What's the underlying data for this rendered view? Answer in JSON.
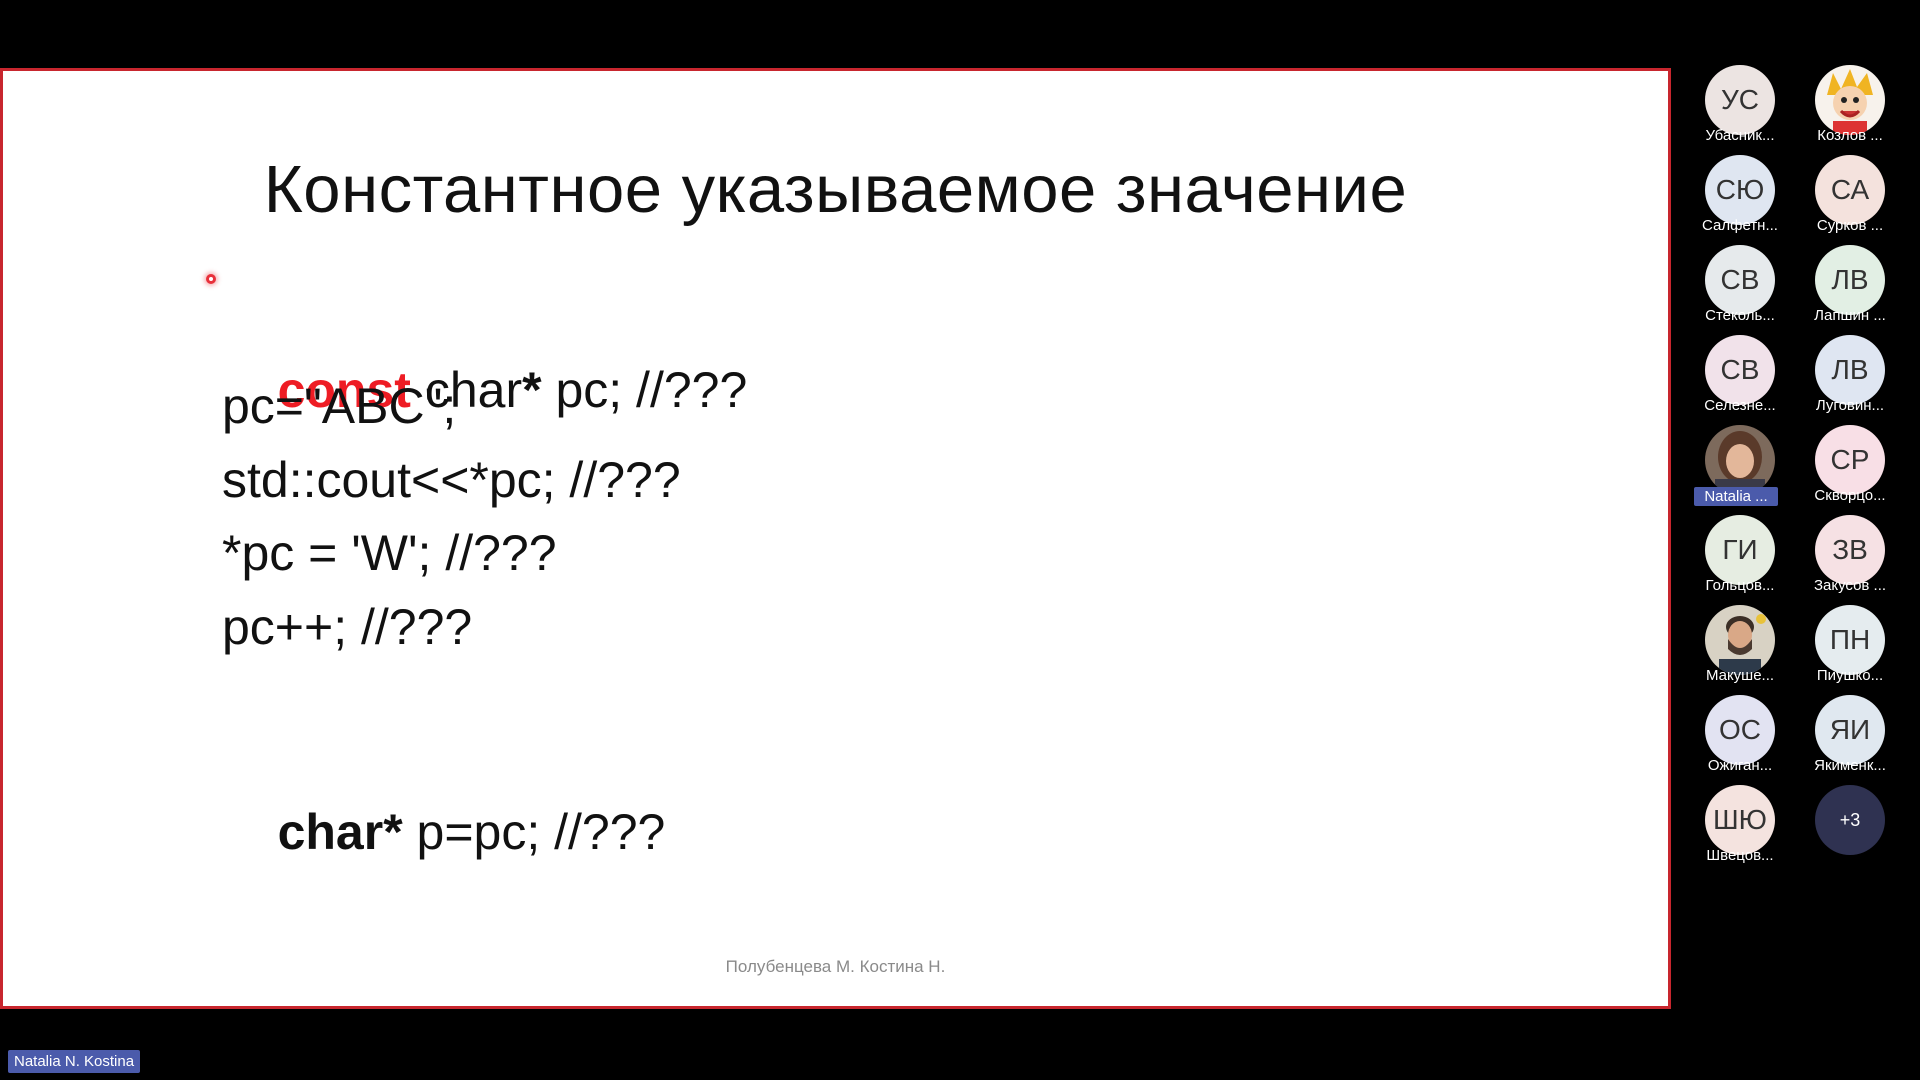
{
  "slide": {
    "title": "Константное указываемое значение",
    "lines": [
      {
        "a": "const",
        "b": " char",
        "c": "*",
        "d": " pc; //???"
      },
      {
        "text": "pc=\"ABC\";"
      },
      {
        "text": "std::cout<<*pc; //???"
      },
      {
        "text": "*pc = 'W'; //???"
      },
      {
        "text": "pc++; //???"
      },
      {
        "a": "char*",
        "b": " p=pc; //???"
      }
    ],
    "footer": "Полубенцева М. Костина Н."
  },
  "participants": [
    {
      "initials": "УС",
      "name": "Убасник...",
      "color": "#ece4e2"
    },
    {
      "initials": "",
      "name": "Козлов ...",
      "color": "#f4f4f4",
      "icon": "cartoon-avatar-photo"
    },
    {
      "initials": "СЮ",
      "name": "Салфетн...",
      "color": "#dfe6f1"
    },
    {
      "initials": "СА",
      "name": "Сурков ...",
      "color": "#f4e2dd"
    },
    {
      "initials": "СВ",
      "name": "Стеколь...",
      "color": "#e6eaec"
    },
    {
      "initials": "ЛВ",
      "name": "Лапшин ...",
      "color": "#e2efe4"
    },
    {
      "initials": "СВ",
      "name": "Селезне...",
      "color": "#f1e2ea"
    },
    {
      "initials": "ЛВ",
      "name": "Луговин...",
      "color": "#dfe6f2"
    },
    {
      "initials": "",
      "name": "Natalia ...",
      "color": "#9a7664",
      "icon": "woman-photo"
    },
    {
      "initials": "СР",
      "name": "Скворцо...",
      "color": "#f8dfe6"
    },
    {
      "initials": "ГИ",
      "name": "Гольцов...",
      "color": "#e6ede2"
    },
    {
      "initials": "ЗВ",
      "name": "Закусов ...",
      "color": "#f6e1e4"
    },
    {
      "initials": "",
      "name": "Макуше...",
      "color": "#c8c0b2",
      "icon": "man-photo"
    },
    {
      "initials": "ПН",
      "name": "Пиушко...",
      "color": "#e5ecef"
    },
    {
      "initials": "ОС",
      "name": "Ожиган...",
      "color": "#e2e3f2"
    },
    {
      "initials": "ЯИ",
      "name": "Якименк...",
      "color": "#e0e8f0"
    },
    {
      "initials": "ШЮ",
      "name": "Швецов...",
      "color": "#f4e3df"
    },
    {
      "initials": "+3",
      "name": "",
      "color": "#2f3251"
    }
  ],
  "speaker": {
    "label": "Natalia N. Kostina"
  }
}
